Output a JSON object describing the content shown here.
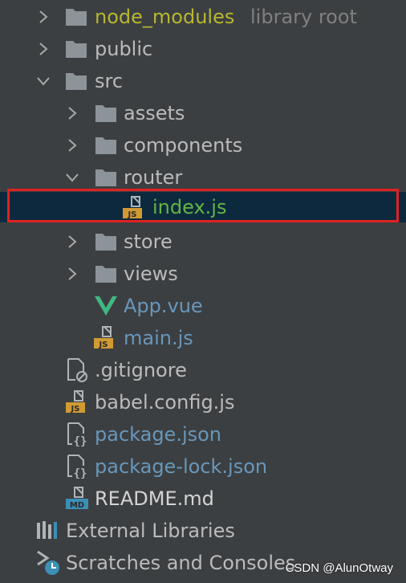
{
  "tree": {
    "node_modules": {
      "label": "node_modules",
      "hint": "library root"
    },
    "public": {
      "label": "public"
    },
    "src": {
      "label": "src"
    },
    "assets": {
      "label": "assets"
    },
    "components": {
      "label": "components"
    },
    "router": {
      "label": "router"
    },
    "index_js": {
      "label": "index.js"
    },
    "store": {
      "label": "store"
    },
    "views": {
      "label": "views"
    },
    "app_vue": {
      "label": "App.vue"
    },
    "main_js": {
      "label": "main.js"
    },
    "gitignore": {
      "label": ".gitignore"
    },
    "babel_config": {
      "label": "babel.config.js"
    },
    "package_json": {
      "label": "package.json"
    },
    "package_lock": {
      "label": "package-lock.json"
    },
    "readme": {
      "label": "README.md"
    },
    "external_libraries": {
      "label": "External Libraries"
    },
    "scratches": {
      "label": "Scratches and Consoles"
    }
  },
  "badges": {
    "js": "JS",
    "md": "MD"
  },
  "watermark": "CSDN @AlunOtway",
  "colors": {
    "background": "#3c3f41",
    "selection": "#0d293e",
    "highlight_border": "#e02222",
    "folder": "#8c9399",
    "excluded": "#b7b731",
    "modified": "#62b543",
    "changed": "#6897bb",
    "js_badge": "#d19a33",
    "md_badge": "#3c8fb5",
    "vue_logo": "#41b883"
  }
}
